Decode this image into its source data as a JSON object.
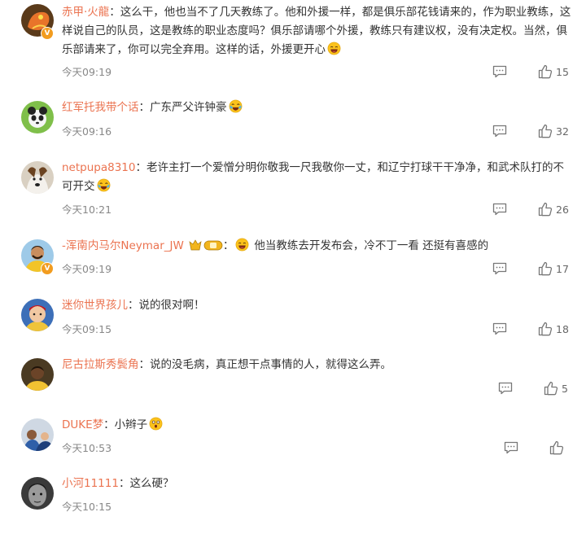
{
  "comments": [
    {
      "username": "赤甲·火龍",
      "sep": "：",
      "text": "这么干，他也当不了几天教练了。他和外援一样，都是俱乐部花钱请来的，作为职业教练，这样说自己的队员，这是教练的职业态度吗？俱乐部请哪个外援，教练只有建议权，没有决定权。当然，俱乐部请来了，你可以完全弃用。这样的话，外援更开心",
      "time": "今天09:19",
      "likes": "15"
    },
    {
      "username": "红军托我带个话",
      "sep": "：",
      "text": "广东严父许钟豪",
      "time": "今天09:16",
      "likes": "32"
    },
    {
      "username": "netpupa8310",
      "sep": "：",
      "text": "老许主打一个爱憎分明你敬我一尺我敬你一丈，和辽宁打球干干净净，和武术队打的不可开交",
      "time": "今天10:21",
      "likes": "26"
    },
    {
      "username": "-浑南内马尔Neymar_JW",
      "sep": "：",
      "text": "他当教练去开发布会，冷不丁一看 还挺有喜感的",
      "time": "今天09:19",
      "likes": "17"
    },
    {
      "username": "迷你世界孩儿",
      "sep": "：",
      "text": "说的很对啊！",
      "time": "今天09:15",
      "likes": "18"
    },
    {
      "username": "尼古拉斯秀鬓角",
      "sep": "：",
      "text": "说的没毛病，真正想干点事情的人，就得这么弄。",
      "time": "",
      "likes": "5"
    },
    {
      "username": "DUKE梦",
      "sep": "：",
      "text": "小辫子",
      "time": "今天10:53",
      "likes": ""
    },
    {
      "username": "小河11111",
      "sep": "：",
      "text": "这么硬？",
      "time": "今天10:15",
      "likes": ""
    }
  ],
  "icons": {
    "reply": "comment-icon",
    "like": "thumbs-up-icon",
    "verified": "verified-badge-icon",
    "emoji": "emoji-icon"
  },
  "colors": {
    "username": "#eb7350",
    "text": "#333333",
    "meta": "#888888",
    "verified": "#f29c1f"
  }
}
